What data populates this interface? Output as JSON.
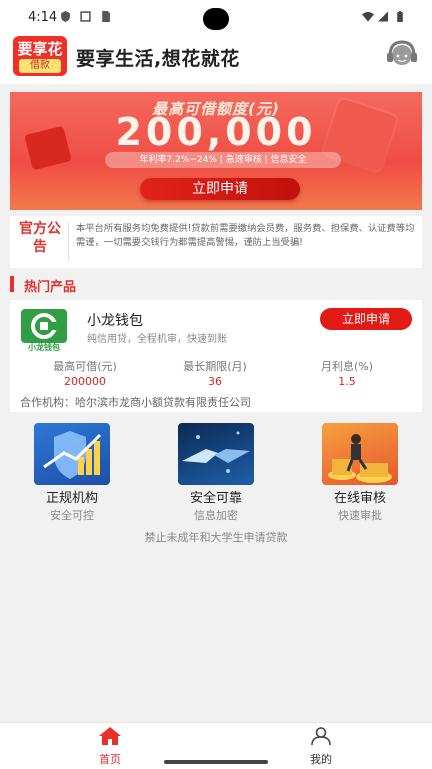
{
  "status_bar": {
    "time": "4:14"
  },
  "header": {
    "logo_top": "要享花",
    "logo_bottom": "借款",
    "title": "要享生活,想花就花",
    "icon": "customer-service-icon"
  },
  "banner": {
    "label": "最高可借额度(元)",
    "amount": "200,000",
    "rate_text": "年利率7.2%~24%  |  急速审核  |  信息安全",
    "button_label": "立即申请"
  },
  "notice": {
    "tag": "官方公告",
    "text": "本平台所有服务均免费提供!贷款前需要缴纳会员费，服务费、担保费、认证费等均需谨，一切需要交钱行为都需提高警惕，谨防上当受骗!"
  },
  "section": {
    "title": "热门产品"
  },
  "product": {
    "logo_text": "小龙钱包",
    "name": "小龙钱包",
    "desc": "纯信用贷，全程机审，快速到账",
    "button_label": "立即申请",
    "stats": [
      {
        "label": "最高可借(元)",
        "value": "200000"
      },
      {
        "label": "最长期限(月)",
        "value": "36"
      },
      {
        "label": "月利息(%)",
        "value": "1.5"
      }
    ],
    "partner": "合作机构：哈尔滨市龙商小额贷款有限责任公司"
  },
  "features": [
    {
      "title": "正规机构",
      "sub": "安全可控",
      "icon": "shield-chart-image"
    },
    {
      "title": "安全可靠",
      "sub": "信息加密",
      "icon": "handshake-image"
    },
    {
      "title": "在线审核",
      "sub": "快速审批",
      "icon": "businessman-coins-image"
    }
  ],
  "disclaimer": "禁止未成年和大学生申请贷款",
  "tabbar": {
    "items": [
      {
        "label": "首页",
        "icon": "home-icon",
        "active": true
      },
      {
        "label": "我的",
        "icon": "user-icon",
        "active": false
      }
    ]
  },
  "colors": {
    "accent": "#e8302a",
    "banner": "#ef4d44",
    "active_tab": "#e8302a"
  }
}
